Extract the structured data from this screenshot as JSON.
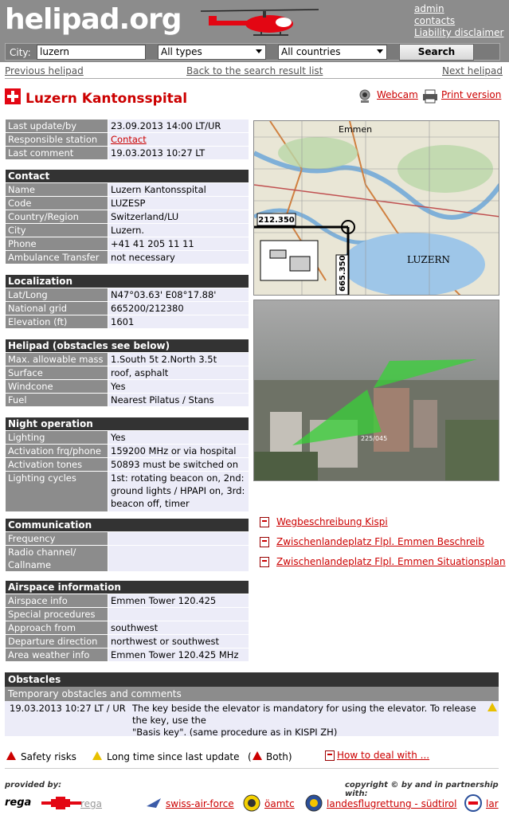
{
  "header": {
    "logo": "helipad.org",
    "links": [
      "admin",
      "contacts",
      "Liability disclaimer"
    ],
    "city_label": "City:",
    "city_value": "luzern",
    "type_select": "All types",
    "country_select": "All countries",
    "search_label": "Search"
  },
  "nav": {
    "previous": "Previous helipad",
    "back": "Back to the search result list",
    "next": "Next helipad"
  },
  "title": "Luzern Kantonsspital",
  "webcam_label": "Webcam",
  "print_label": "Print version",
  "meta": [
    {
      "k": "Last update/by",
      "v": "23.09.2013 14:00 LT/UR"
    },
    {
      "k": "Responsible station",
      "v": "Contact"
    },
    {
      "k": "Last comment",
      "v": "19.03.2013 10:27 LT"
    }
  ],
  "contact": {
    "heading": "Contact",
    "rows": [
      {
        "k": "Name",
        "v": "Luzern Kantonsspital"
      },
      {
        "k": "Code",
        "v": "LUZESP"
      },
      {
        "k": "Country/Region",
        "v": "Switzerland/LU"
      },
      {
        "k": "City",
        "v": "Luzern."
      },
      {
        "k": "Phone",
        "v": "+41 41 205 11 11"
      },
      {
        "k": "Ambulance Transfer",
        "v": "not necessary"
      }
    ]
  },
  "localization": {
    "heading": "Localization",
    "rows": [
      {
        "k": "Lat/Long",
        "v": "N47°03.63' E08°17.88'"
      },
      {
        "k": "National grid",
        "v": "665200/212380"
      },
      {
        "k": "Elevation (ft)",
        "v": "1601"
      }
    ]
  },
  "helipad": {
    "heading": "Helipad (obstacles see below)",
    "rows": [
      {
        "k": "Max. allowable mass",
        "v": "1.South 5t 2.North 3.5t"
      },
      {
        "k": "Surface",
        "v": "roof, asphalt"
      },
      {
        "k": "Windcone",
        "v": "Yes"
      },
      {
        "k": "Fuel",
        "v": "Nearest Pilatus / Stans"
      }
    ]
  },
  "night": {
    "heading": "Night operation",
    "rows": [
      {
        "k": "Lighting",
        "v": "Yes"
      },
      {
        "k": "Activation frq/phone",
        "v": "159200 MHz or via hospital"
      },
      {
        "k": "Activation tones",
        "v": "50893 must be switched on"
      },
      {
        "k": "Lighting cycles",
        "v": "1st: rotating beacon on, 2nd: ground lights / HPAPI on, 3rd: beacon off, timer"
      }
    ]
  },
  "communication": {
    "heading": "Communication",
    "rows": [
      {
        "k": "Frequency",
        "v": ""
      },
      {
        "k": "Radio channel/ Callname",
        "v": ""
      }
    ]
  },
  "airspace": {
    "heading": "Airspace information",
    "rows": [
      {
        "k": "Airspace info",
        "v": "Emmen Tower 120.425"
      },
      {
        "k": "Special procedures",
        "v": ""
      },
      {
        "k": "Approach from",
        "v": "southwest"
      },
      {
        "k": "Departure direction",
        "v": "northwest or southwest"
      },
      {
        "k": "Area weather info",
        "v": "Emmen Tower 120.425 MHz"
      }
    ]
  },
  "map": {
    "place": "LUZERN",
    "top_place": "Emmen",
    "coord_x": "212.350",
    "coord_y": "665.350"
  },
  "photo_caption": "225/045",
  "documents": [
    "Wegbeschreibung Kispi",
    "Zwischenlandeplatz Flpl. Emmen Beschreib",
    "Zwischenlandeplatz Flpl. Emmen Situationsplan"
  ],
  "obstacles": {
    "heading": "Obstacles",
    "sub": "Temporary obstacles and comments",
    "date": "19.03.2013 10:27 LT / UR",
    "text1": "The key beside the elevator is mandatory for using the elevator. To release the key, use the",
    "text2": "\"Basis key\". (same procedure as in KISPI ZH)"
  },
  "legend": {
    "safety": "Safety risks",
    "longtime": "Long time since last update",
    "both_open": "(",
    "both": "Both)",
    "howto": "How to deal with ..."
  },
  "footer": {
    "provided": "provided by:",
    "copyright": "copyright © by and in partnership with:",
    "rega_logo": "rega",
    "partners": [
      "rega",
      "swiss-air-force",
      "öamtc",
      "landesflugrettung - südtirol",
      "lar"
    ]
  },
  "colors": {
    "accent": "#cc0000",
    "header": "#8c8c8c",
    "section": "#333333",
    "row_bg": "#ececf8"
  }
}
